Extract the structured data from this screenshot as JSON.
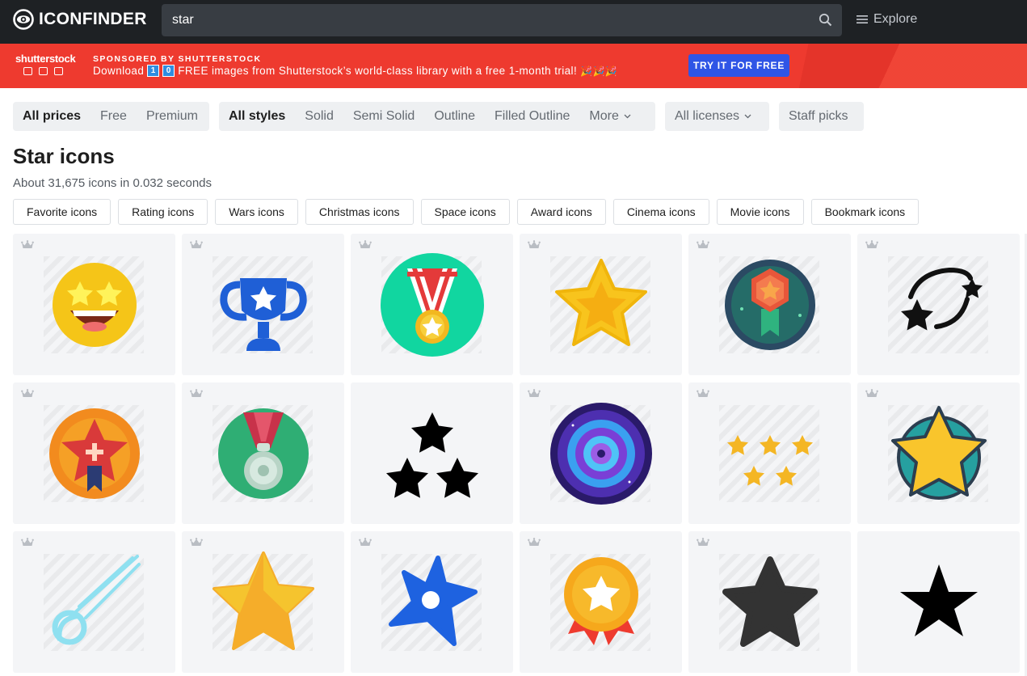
{
  "header": {
    "logo_text": "ICONFINDER",
    "search_value": "star",
    "explore_label": "Explore"
  },
  "banner": {
    "brand": "shutterstock",
    "sponsor": "SPONSORED BY SHUTTERSTOCK",
    "text_before": "Download",
    "digits": [
      "1",
      "0"
    ],
    "text_after": "FREE images from Shutterstock’s world-class library with a free 1-month trial!",
    "emoji": "🎉🎉🎉",
    "cta": "TRY IT FOR FREE"
  },
  "filters": {
    "prices": [
      "All prices",
      "Free",
      "Premium"
    ],
    "styles": [
      "All styles",
      "Solid",
      "Semi Solid",
      "Outline",
      "Filled Outline",
      "More"
    ],
    "licenses": "All licenses",
    "staff_picks": "Staff picks"
  },
  "page": {
    "title": "Star icons",
    "result_summary": "About 31,675 icons in 0.032 seconds"
  },
  "related_tags": [
    "Favorite icons",
    "Rating icons",
    "Wars icons",
    "Christmas icons",
    "Space icons",
    "Award icons",
    "Cinema icons",
    "Movie icons",
    "Bookmark icons"
  ],
  "icons": [
    "star-eyes-emoji-icon",
    "trophy-star-icon",
    "medal-ribbon-icon",
    "star-gold-icon",
    "badge-star-icon",
    "shooting-stars-outline-icon",
    "star-badge-sunburst-icon",
    "medal-green-icon",
    "three-stars-icon",
    "galaxy-spiral-icon",
    "five-stars-rating-icon",
    "star-circle-icon",
    "comet-icon",
    "star-half-shade-icon",
    "shuriken-icon",
    "award-ribbon-icon",
    "star-dark-icon",
    "star-black-icon"
  ],
  "colors": {
    "header_bg": "#1e2124",
    "banner_red": "#ee3a2f",
    "cta_blue": "#2f55e6",
    "card_bg": "#f4f5f7"
  }
}
